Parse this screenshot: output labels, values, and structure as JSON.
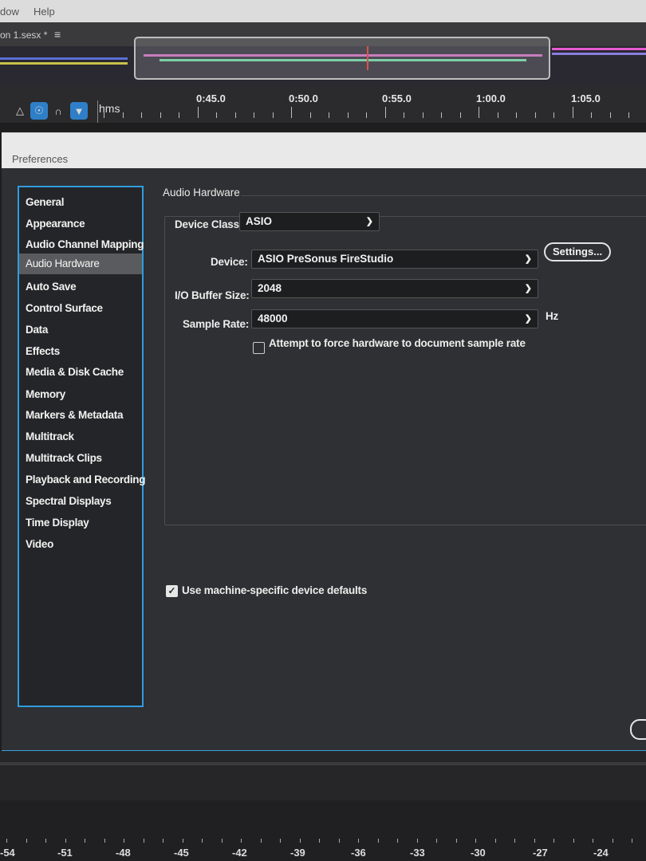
{
  "menubar": {
    "items": [
      "dow",
      "Help"
    ]
  },
  "document_tab": {
    "name": "on 1.sesx *",
    "menu_icon": "hamburger-icon"
  },
  "timeline_ruler": {
    "units": "hms",
    "labels": [
      "0:45.0",
      "0:50.0",
      "0:55.0",
      "1:00.0",
      "1:05.0"
    ],
    "tools": [
      "metronome-icon",
      "snap-icon",
      "loop-icon",
      "marker-icon"
    ]
  },
  "dialog": {
    "title": "Preferences",
    "categories": [
      "General",
      "Appearance",
      "Audio Channel Mapping",
      "Audio Hardware",
      "Auto Save",
      "Control Surface",
      "Data",
      "Effects",
      "Media & Disk Cache",
      "Memory",
      "Markers & Metadata",
      "Multitrack",
      "Multitrack Clips",
      "Playback and Recording",
      "Spectral Displays",
      "Time Display",
      "Video"
    ],
    "selected_category": "Audio Hardware",
    "section_title": "Audio Hardware",
    "device_class": {
      "label": "Device Class:",
      "value": "ASIO"
    },
    "device": {
      "label": "Device:",
      "value": "ASIO PreSonus FireStudio"
    },
    "settings_button": "Settings...",
    "buffer_size": {
      "label": "I/O Buffer Size:",
      "value": "2048"
    },
    "sample_rate": {
      "label": "Sample Rate:",
      "value": "48000",
      "unit": "Hz"
    },
    "force_sample_rate": {
      "label": "Attempt to force hardware to document sample rate",
      "checked": false
    },
    "machine_defaults": {
      "label": "Use machine-specific device defaults",
      "checked": true
    }
  },
  "level_meter": {
    "labels": [
      "-54",
      "-51",
      "-48",
      "-45",
      "-42",
      "-39",
      "-36",
      "-33",
      "-30",
      "-27",
      "-24"
    ]
  },
  "colors": {
    "accent": "#2f9de0",
    "selected_bg": "#5a5b5e",
    "dialog_bg": "#2f3033"
  }
}
